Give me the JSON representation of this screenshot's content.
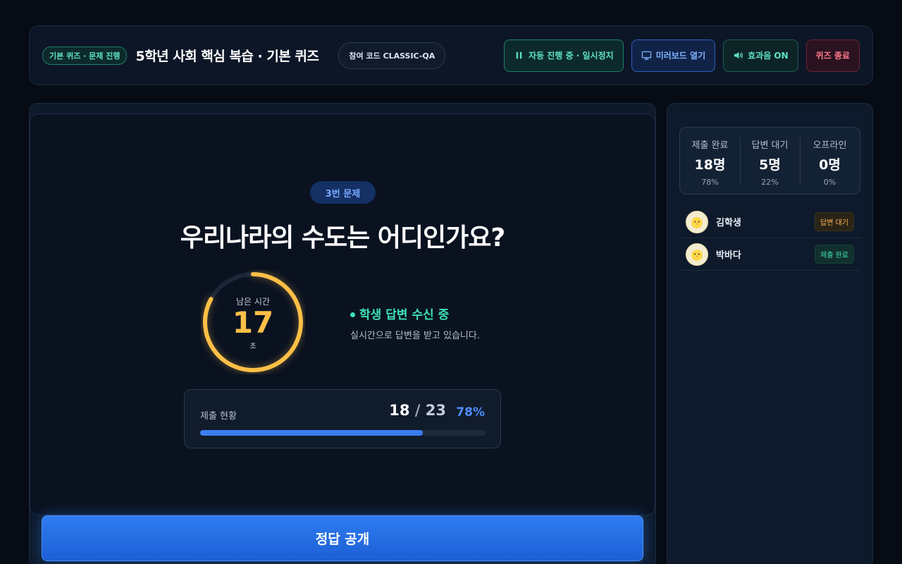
{
  "header": {
    "mode_badge": "기본 퀴즈 · 문제 진행",
    "title": "5학년 사회 핵심 복습 · 기본 퀴즈",
    "join_code": "참여 코드 CLASSIC-QA",
    "buttons": {
      "auto": "자동 진행 중 · 일시정지",
      "mirror": "미러보드 열기",
      "sound": "효과음 ON",
      "end": "퀴즈 종료"
    }
  },
  "question": {
    "badge": "3번 문제",
    "text": "우리나라의 수도는 어디인가요?"
  },
  "timer": {
    "label": "남은 시간",
    "value": "17",
    "unit": "초",
    "fraction_remaining": 0.83
  },
  "status": {
    "title": "학생 답변 수신 중",
    "subtitle": "실시간으로 답변을 받고 있습니다."
  },
  "progress": {
    "label": "제출 현황",
    "submitted": "18",
    "separator": "/",
    "total": "23",
    "percent": "78%",
    "fraction": 0.78
  },
  "reveal_button": "정답 공개",
  "stats": [
    {
      "label": "제출 완료",
      "value": "18명",
      "pct": "78%"
    },
    {
      "label": "답변 대기",
      "value": "5명",
      "pct": "22%"
    },
    {
      "label": "오프라인",
      "value": "0명",
      "pct": "0%"
    }
  ],
  "students": [
    {
      "name": "김학생",
      "status": "답변 대기"
    },
    {
      "name": "박바다",
      "status": "제출 완료"
    }
  ],
  "colors": {
    "accent": "#3b7df0",
    "timer": "#ffbf47",
    "success": "#3fe0b4",
    "danger": "#ff7a8c"
  }
}
